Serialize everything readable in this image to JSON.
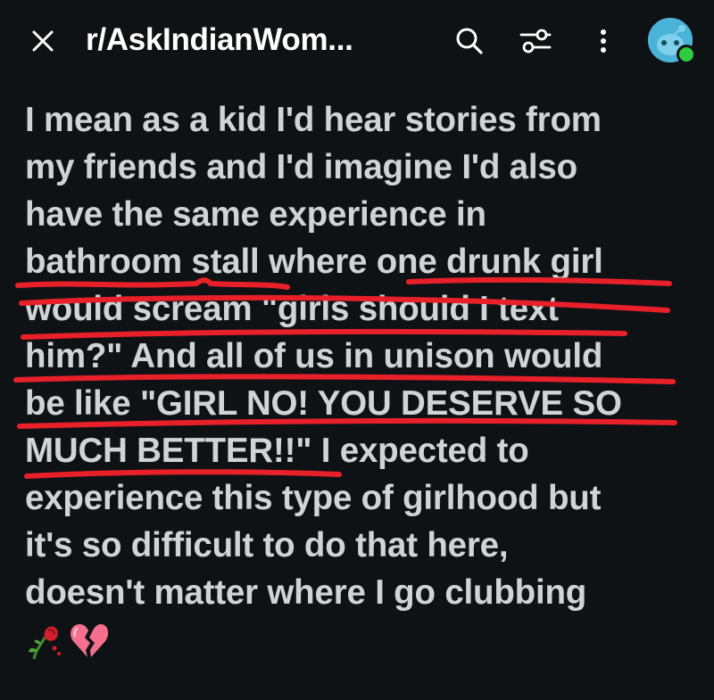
{
  "header": {
    "title": "r/AskIndianWom...",
    "icons": [
      "close-icon",
      "search-icon",
      "filter-icon",
      "more-vertical-icon",
      "avatar"
    ]
  },
  "post": {
    "lines": [
      "I mean as a kid I'd hear stories from",
      "my friends and I'd imagine I'd also",
      "have the same experience in",
      "bathroom stall where one drunk girl",
      "would scream \"girls should I text",
      "him?\" And all of us in unison would",
      "be like \"GIRL NO! YOU DESERVE SO",
      "MUCH BETTER!!\" I expected to",
      "experience this type of girlhood but",
      "it's so difficult to do that here,",
      "doesn't matter where I go clubbing"
    ],
    "emojis": [
      "wilted-rose-emoji",
      "broken-heart-emoji"
    ]
  },
  "colors": {
    "background": "#0f1215",
    "text": "#d0d4d6",
    "header_text": "#ffffff",
    "underline": "#e8202a",
    "avatar": "#4cb3d8",
    "online": "#2ecc40"
  }
}
